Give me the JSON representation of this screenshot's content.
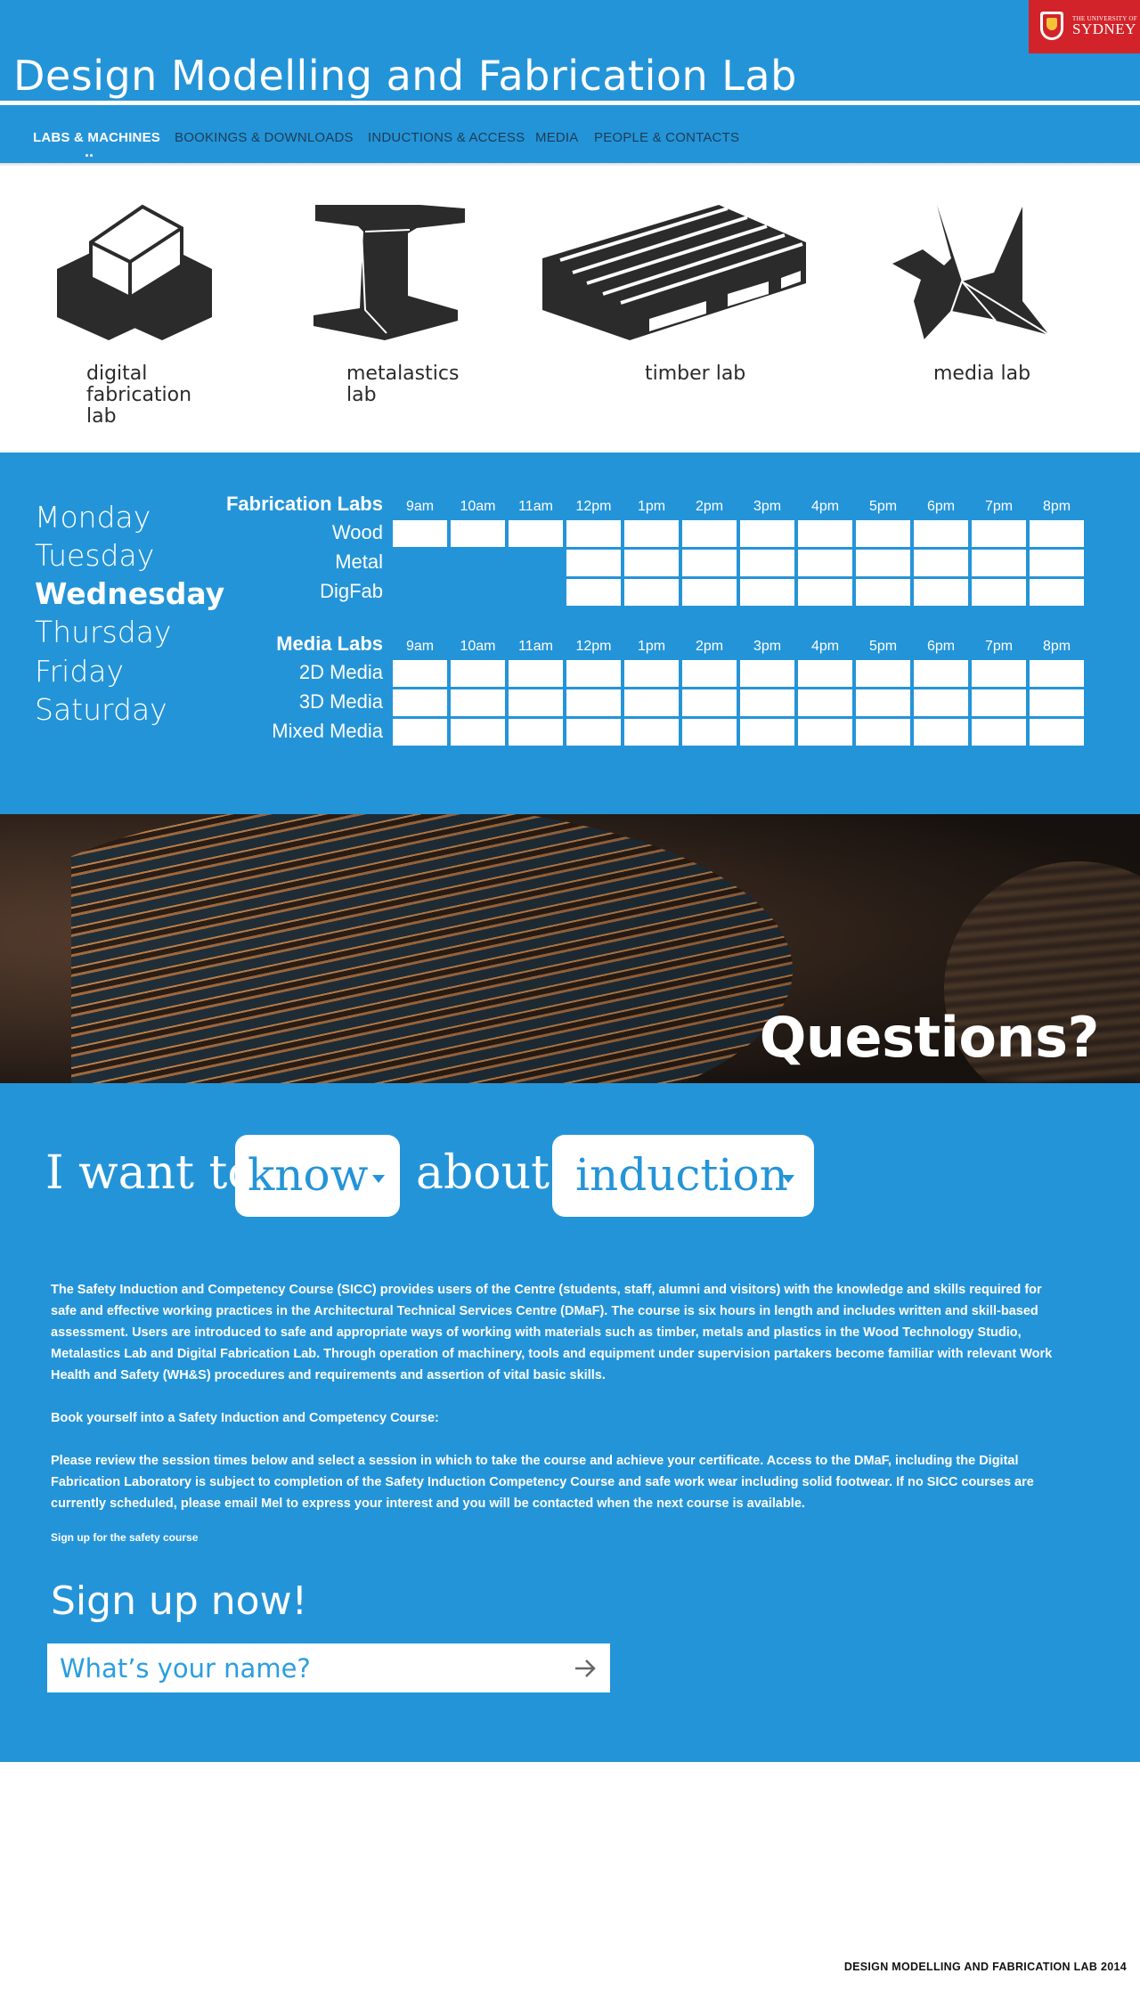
{
  "header": {
    "title": "Design Modelling and Fabrication Lab",
    "logo_small": "THE UNIVERSITY OF",
    "logo_big": "SYDNEY",
    "colors": {
      "primary": "#2494d8",
      "logo_red": "#d2232a"
    }
  },
  "nav": {
    "items": [
      {
        "label": "LABS & MACHINES",
        "active": true
      },
      {
        "label": "BOOKINGS & DOWNLOADS"
      },
      {
        "label": "INDUCTIONS & ACCESS"
      },
      {
        "label": "MEDIA"
      },
      {
        "label": "PEOPLE & CONTACTS"
      }
    ]
  },
  "labs": [
    {
      "label": "digital\nfabrication lab",
      "icon": "cube-blocks-icon"
    },
    {
      "label": "metalastics\nlab",
      "icon": "i-beam-icon"
    },
    {
      "label": "timber lab",
      "icon": "pallet-icon"
    },
    {
      "label": "media lab",
      "icon": "origami-crane-icon"
    }
  ],
  "schedule": {
    "days": [
      "Monday",
      "Tuesday",
      "Wednesday",
      "Thursday",
      "Friday",
      "Saturday"
    ],
    "selected_day": "Wednesday",
    "hours": [
      "9am",
      "10am",
      "11am",
      "12pm",
      "1pm",
      "2pm",
      "3pm",
      "4pm",
      "5pm",
      "6pm",
      "7pm",
      "8pm"
    ],
    "groups": [
      {
        "title": "Fabrication Labs",
        "rows": [
          {
            "label": "Wood",
            "available_from_index": 0
          },
          {
            "label": "Metal",
            "available_from_index": 3
          },
          {
            "label": "DigFab",
            "available_from_index": 3
          }
        ]
      },
      {
        "title": "Media Labs",
        "rows": [
          {
            "label": "2D Media",
            "available_from_index": 0
          },
          {
            "label": "3D Media",
            "available_from_index": 0
          },
          {
            "label": "Mixed Media",
            "available_from_index": 0
          }
        ]
      }
    ]
  },
  "banner": {
    "title": "Questions?"
  },
  "questions": {
    "prefix": "I want to",
    "verb": "know",
    "middle": "about",
    "topic": "induction",
    "paragraph1": "The Safety Induction and Competency Course (SICC) provides users of the Centre (students, staff, alumni and visitors) with the knowledge and skills required for safe and effective working practices in the Architectural Technical Services Centre (DMaF). The course is six hours in length and includes written and skill-based assessment. Users are introduced to safe and appropriate ways of working with materials such as timber, metals and plastics in the Wood Technology Studio, Metalastics Lab and Digital Fabrication Lab. Through operation of machinery, tools and equipment under supervision partakers become familiar with relevant Work Health and Safety (WH&S) procedures and requirements and assertion of vital basic skills.",
    "paragraph2": "Book yourself into a Safety Induction and Competency Course:",
    "paragraph3": "Please review the session times below and select a session in which to take the course and achieve your certificate. Access to the DMaF, including the Digital Fabrication Laboratory is subject to completion of the Safety Induction Competency Course and safe work wear including solid footwear. If no SICC courses are currently scheduled, please email Mel to express your interest and you will be contacted when the next course is available.",
    "link": "Sign up for the safety course"
  },
  "signup": {
    "title": "Sign up now!",
    "placeholder": "What’s your name?",
    "value": ""
  },
  "footer": {
    "text": "DESIGN MODELLING AND FABRICATION LAB 2014"
  }
}
